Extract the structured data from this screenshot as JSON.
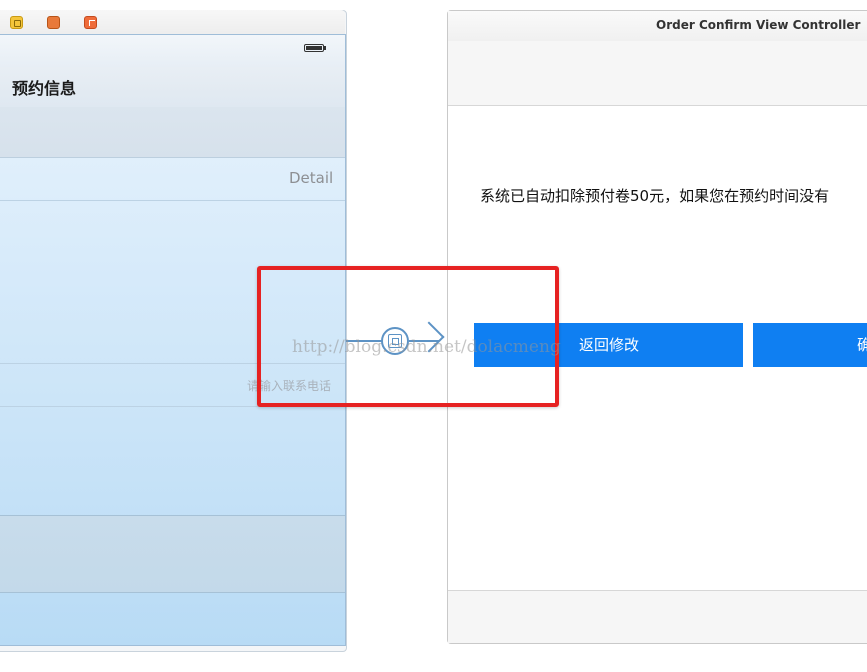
{
  "left_scene": {
    "nav_title": "预约信息",
    "cell_detail_label": "Detail",
    "phone_placeholder": "请输入联系电话"
  },
  "right_scene": {
    "title": "Order Confirm View Controller",
    "message": "系统已自动扣除预付卷50元，如果您在预约时间没有",
    "buttons": {
      "back_label": "返回修改",
      "confirm_label": "确"
    }
  },
  "watermark": "http://blog.csdn.net/dolacmeng",
  "colors": {
    "button_blue": "#0f7ff2",
    "segue_blue": "#5d93c5",
    "highlight_red": "#e62222"
  },
  "icons": {
    "dock": [
      "view-controller-icon",
      "first-responder-icon",
      "exit-icon"
    ],
    "segue": "segue-show-icon"
  }
}
